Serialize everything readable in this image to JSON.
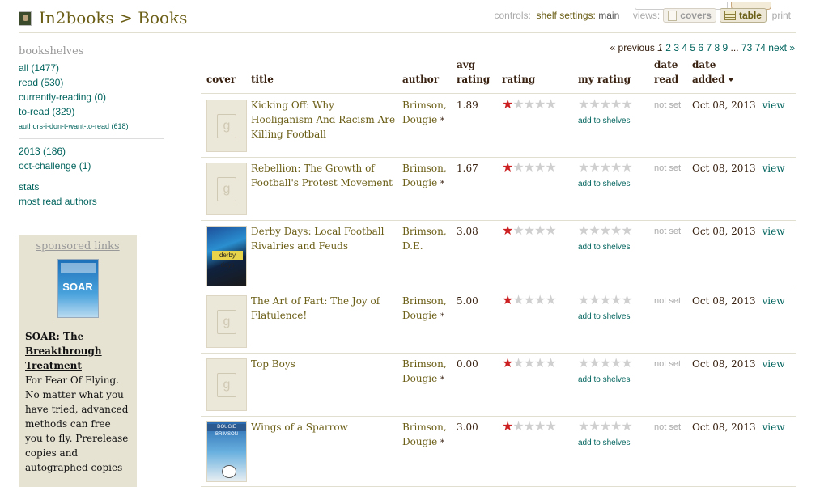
{
  "header": {
    "user": "In2books",
    "separator": ">",
    "section": "Books",
    "controls_label": "controls:",
    "shelf_settings_label": "shelf settings:",
    "shelf_settings_value": "main",
    "views_label": "views:",
    "view_covers": "covers",
    "view_table": "table",
    "print": "print"
  },
  "sidebar": {
    "heading": "bookshelves",
    "shelves": [
      {
        "label": "all (1477)"
      },
      {
        "label": "read (530)"
      },
      {
        "label": "currently-reading (0)"
      },
      {
        "label": "to-read (329)"
      },
      {
        "label": "authors-i-don-t-want-to-read (618)"
      }
    ],
    "custom": [
      {
        "label": "2013 (186)"
      },
      {
        "label": "oct-challenge (1)"
      }
    ],
    "stats": "stats",
    "most_read": "most read authors"
  },
  "sponsor": {
    "heading": "sponsored links",
    "cover_text": "SOAR",
    "title": "SOAR: The Breakthrough Treatment",
    "text": "For Fear Of Flying. No matter what you have tried, advanced methods can free you to fly. Prerelease copies and autographed copies"
  },
  "pager": {
    "previous": "« previous",
    "current": "1",
    "pages": [
      "2",
      "3",
      "4",
      "5",
      "6",
      "7",
      "8",
      "9"
    ],
    "ellipsis": "...",
    "last_pages": [
      "73",
      "74"
    ],
    "next": "next »"
  },
  "columns": {
    "cover": "cover",
    "title": "title",
    "author": "author",
    "avg_rating_1": "avg",
    "avg_rating_2": "rating",
    "rating": "rating",
    "my_rating": "my rating",
    "date_read_1": "date",
    "date_read_2": "read",
    "date_added_1": "date",
    "date_added_2": "added"
  },
  "books": [
    {
      "title": "Kicking Off: Why Hooliganism And Racism Are Killing Football",
      "author": "Brimson, Dougie",
      "author_star": "*",
      "avg": "1.89",
      "rating": 1,
      "my_rating": 0,
      "add": "add to shelves",
      "date_read": "not set",
      "date_added": "Oct 08, 2013",
      "view": "view",
      "cover": "placeholder"
    },
    {
      "title": "Rebellion: The Growth of Football's Protest Movement",
      "author": "Brimson, Dougie",
      "author_star": "*",
      "avg": "1.67",
      "rating": 1,
      "my_rating": 0,
      "add": "add to shelves",
      "date_read": "not set",
      "date_added": "Oct 08, 2013",
      "view": "view",
      "cover": "placeholder"
    },
    {
      "title": "Derby Days: Local Football Rivalries and Feuds",
      "author": "Brimson, D.E.",
      "author_star": "",
      "avg": "3.08",
      "rating": 1,
      "my_rating": 0,
      "add": "add to shelves",
      "date_read": "not set",
      "date_added": "Oct 08, 2013",
      "view": "view",
      "cover": "derby",
      "cover_text": "derby days"
    },
    {
      "title": "The Art of Fart: The Joy of Flatulence!",
      "author": "Brimson, Dougie",
      "author_star": "*",
      "avg": "5.00",
      "rating": 1,
      "my_rating": 0,
      "add": "add to shelves",
      "date_read": "not set",
      "date_added": "Oct 08, 2013",
      "view": "view",
      "cover": "placeholder"
    },
    {
      "title": "Top Boys",
      "author": "Brimson, Dougie",
      "author_star": "*",
      "avg": "0.00",
      "rating": 1,
      "my_rating": 0,
      "add": "add to shelves",
      "date_read": "not set",
      "date_added": "Oct 08, 2013",
      "view": "view",
      "cover": "placeholder"
    },
    {
      "title": "Wings of a Sparrow",
      "author": "Brimson, Dougie",
      "author_star": "*",
      "avg": "3.00",
      "rating": 1,
      "my_rating": 0,
      "add": "add to shelves",
      "date_read": "not set",
      "date_added": "Oct 08, 2013",
      "view": "view",
      "cover": "sparrow",
      "cover_text": "DOUGIE BRIMSON"
    }
  ]
}
